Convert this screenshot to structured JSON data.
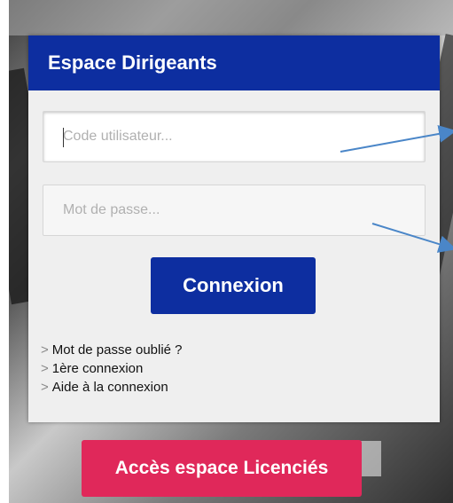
{
  "panel": {
    "title": "Espace Dirigeants"
  },
  "form": {
    "username_placeholder": "Code utilisateur...",
    "username_value": "",
    "password_placeholder": "Mot de passe...",
    "password_value": "",
    "submit_label": "Connexion"
  },
  "links": [
    {
      "prefix": ">",
      "label": "Mot de passe oublié ?"
    },
    {
      "prefix": ">",
      "label": "1ère connexion"
    },
    {
      "prefix": ">",
      "label": "Aide à la connexion"
    }
  ],
  "footer": {
    "licencies_button": "Accès espace Licenciés"
  },
  "colors": {
    "primary": "#0d2ea0",
    "accent": "#e0285a",
    "annotation_arrow": "#4a86c8"
  },
  "icons": [
    "arrow-annotation-icon"
  ]
}
